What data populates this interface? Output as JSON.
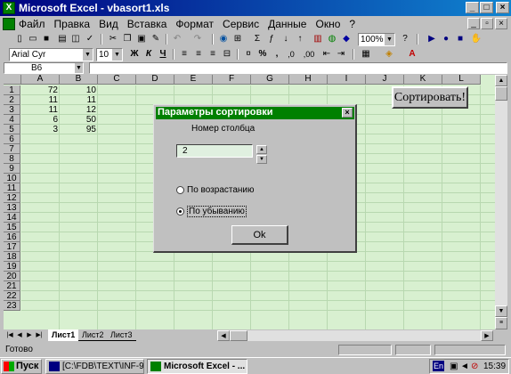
{
  "window": {
    "title": "Microsoft Excel - vbasort1.xls",
    "minimize": "_",
    "maximize": "□",
    "close": "×"
  },
  "menubar": {
    "items": [
      "Файл",
      "Правка",
      "Вид",
      "Вставка",
      "Формат",
      "Сервис",
      "Данные",
      "Окно",
      "?"
    ]
  },
  "toolbar1": {
    "zoom": "100%"
  },
  "toolbar2": {
    "font": "Arial Cyr",
    "size": "10",
    "bold": "Ж",
    "italic": "К",
    "underline": "Ч",
    "percent": "%",
    "comma": ",",
    "decimals_inc": ",0",
    "decimals_dec": ",00"
  },
  "formula": {
    "namebox": "B6",
    "value": ""
  },
  "columns": [
    "A",
    "B",
    "C",
    "D",
    "E",
    "F",
    "G",
    "H",
    "I",
    "J",
    "K",
    "L"
  ],
  "rows": [
    "1",
    "2",
    "3",
    "4",
    "5",
    "6",
    "7",
    "8",
    "9",
    "10",
    "11",
    "12",
    "13",
    "14",
    "15",
    "16",
    "17",
    "18",
    "19",
    "20",
    "21",
    "22",
    "23"
  ],
  "cells": {
    "A": [
      "72",
      "11",
      "11",
      "6",
      "3"
    ],
    "B": [
      "10",
      "11",
      "12",
      "50",
      "95"
    ]
  },
  "sort_button": {
    "label": "Сортировать!"
  },
  "dialog": {
    "title": "Параметры сортировки",
    "close": "×",
    "column_label": "Номер столбца",
    "column_value": "2",
    "radio_asc": "По возрастанию",
    "radio_desc": "По убыванию",
    "selected": "desc",
    "ok": "Ok"
  },
  "sheets": [
    "Лист1",
    "Лист2",
    "Лист3"
  ],
  "status": {
    "text": "Готово"
  },
  "taskbar": {
    "start": "Пуск",
    "items": [
      "[C:\\FDB\\TEXT\\INF-9...",
      "Microsoft Excel - ..."
    ],
    "lang": "En",
    "clock": "15:39"
  }
}
